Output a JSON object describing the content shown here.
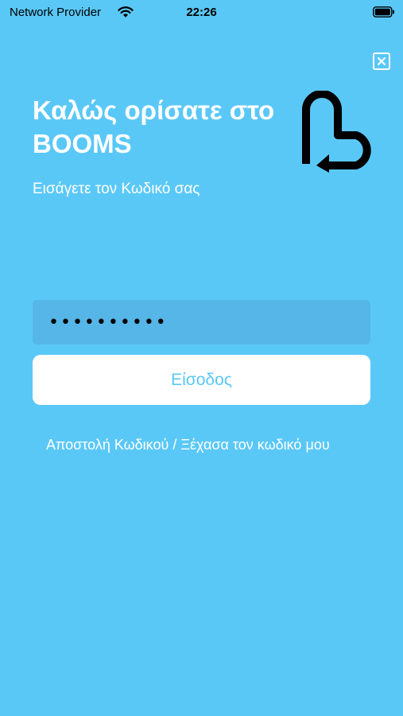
{
  "status_bar": {
    "carrier": "Network Provider",
    "time": "22:26",
    "wifi_icon": "wifi-icon",
    "battery_icon": "battery-icon"
  },
  "header": {
    "close_icon": "close-icon",
    "title": "Καλώς ορίσατε στο BOOMS",
    "subtitle": "Εισάγετε τον Κωδικό σας",
    "logo": "booms-logo-icon"
  },
  "form": {
    "password_value": "••••••••••",
    "login_label": "Είσοδος",
    "forgot_link": "Αποστολή Κωδικού / Ξέχασα τον κωδικό μου"
  },
  "colors": {
    "background": "#5ac8f7",
    "field_background": "#55b6e7",
    "button_background": "#ffffff",
    "button_text": "#5ac8f7",
    "text": "#ffffff"
  }
}
